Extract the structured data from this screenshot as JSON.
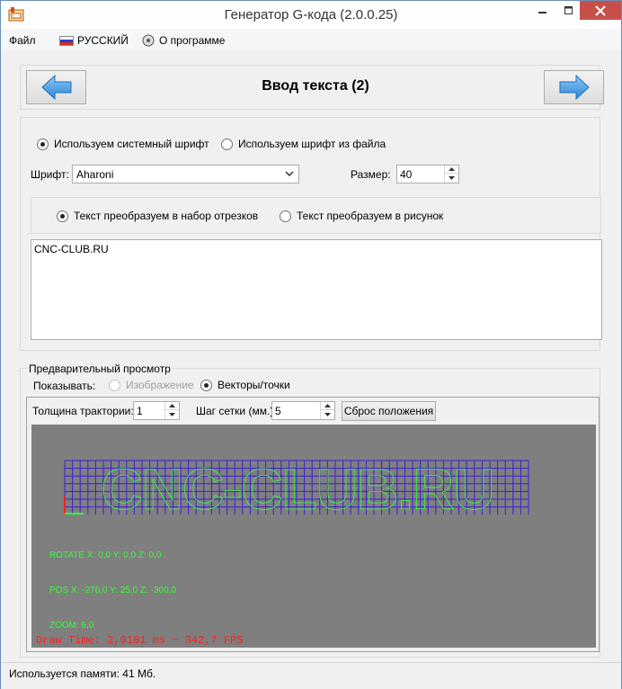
{
  "window": {
    "title": "Генератор G-кода (2.0.0.25)"
  },
  "menu": {
    "file": "Файл",
    "language": "РУССКИЙ",
    "about": "О программе"
  },
  "wizard": {
    "step_title": "Ввод текста (2)"
  },
  "font_source": {
    "system": "Используем системный шрифт",
    "file": "Используем шрифт из файла",
    "selected": "system"
  },
  "font": {
    "label": "Шрифт:",
    "value": "Aharoni",
    "size_label": "Размер:",
    "size_value": "40"
  },
  "conversion": {
    "segments": "Текст преобразуем в набор отрезков",
    "image": "Текст преобразуем в рисунок",
    "selected": "segments"
  },
  "text_input": {
    "value": "CNC-CLUB.RU"
  },
  "preview": {
    "group_title": "Предварительный просмотр",
    "show_label": "Показывать:",
    "show_image": "Изображение",
    "show_vectors": "Векторы/точки",
    "thickness_label": "Толщина трактории:",
    "thickness_value": "1",
    "grid_label": "Шаг сетки (мм.):",
    "grid_value": "5",
    "reset_button": "Сброс положения",
    "canvas": {
      "rendered_text": "CNC-CLUB.RU",
      "rotate": "ROTATE X: 0,0  Y: 0,0 Z: 0,0",
      "pos": "POS X: -276,0  Y: 25,0 Z: -300,0",
      "zoom": "ZOOM: 6,0",
      "draw_time": "Draw Time: 2,9181 ms ~ 342,7 FPS",
      "colors": {
        "background": "#7f7f7f",
        "grid": "#3b1fd6",
        "vectors": "#33ff33",
        "axis": "#ff2020"
      }
    }
  },
  "status": {
    "memory": "Используется памяти:  41  Мб."
  },
  "icons": [
    "app-icon",
    "minimize-icon",
    "maximize-icon",
    "close-icon",
    "russian-flag-icon",
    "about-icon",
    "arrow-left-icon",
    "arrow-right-icon",
    "dropdown-arrow-icon",
    "spin-up-icon",
    "spin-down-icon"
  ]
}
